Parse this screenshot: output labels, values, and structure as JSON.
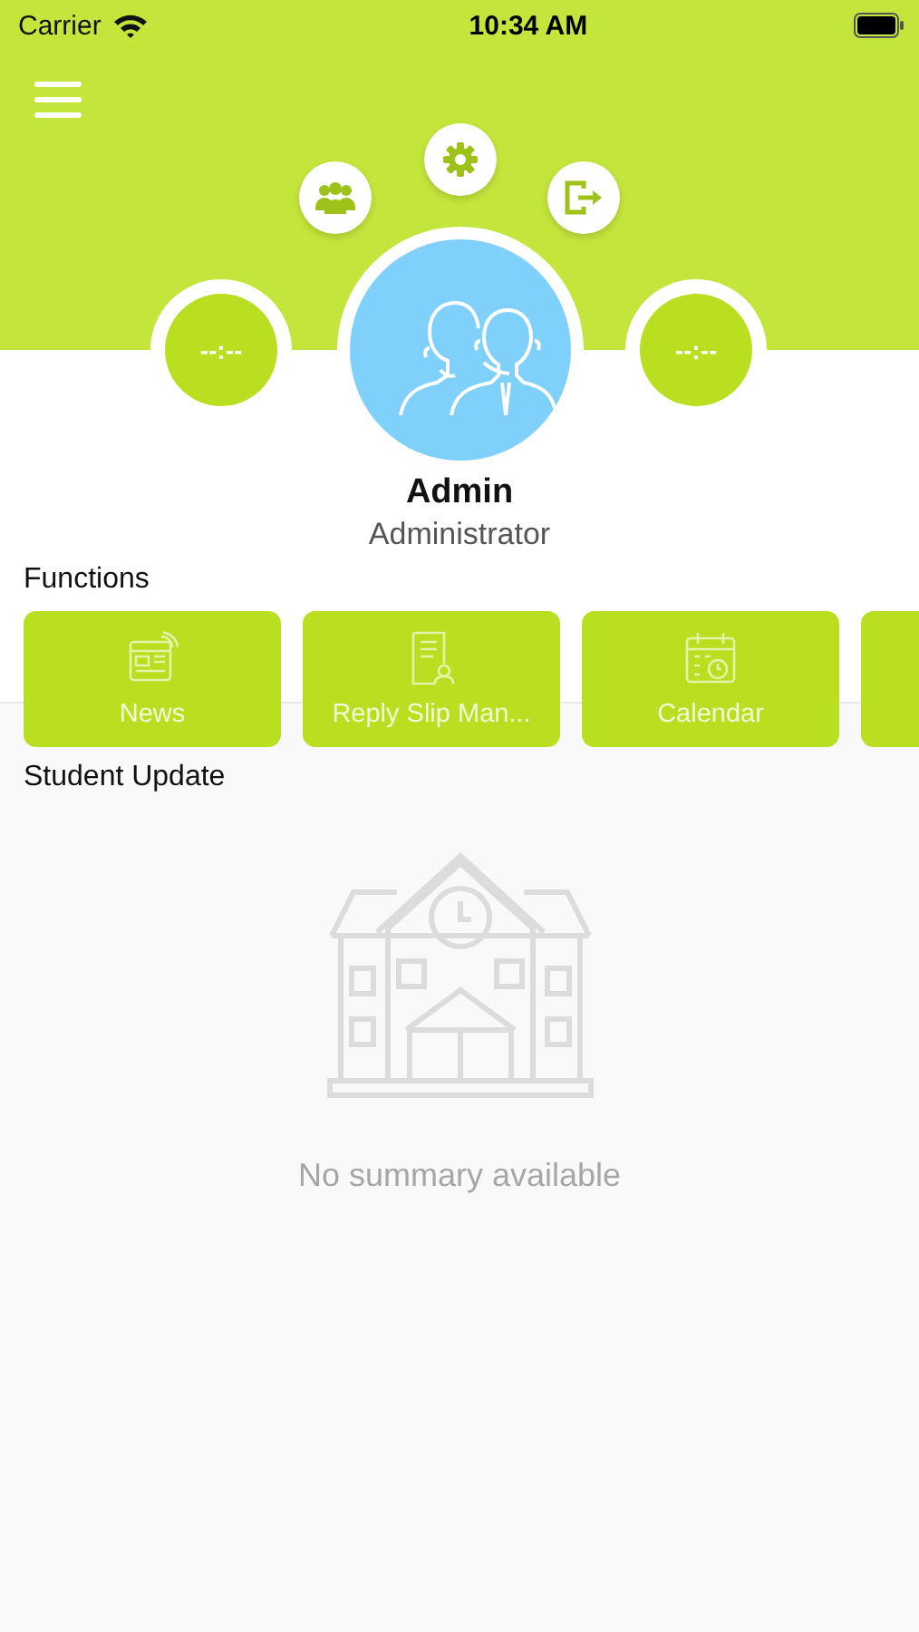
{
  "status_bar": {
    "carrier": "Carrier",
    "time": "10:34 AM"
  },
  "header": {
    "left_timer": "--:--",
    "right_timer": "--:--"
  },
  "profile": {
    "name": "Admin",
    "role": "Administrator"
  },
  "functions": {
    "title": "Functions",
    "items": [
      {
        "label": "News",
        "kind": "news"
      },
      {
        "label": "Reply Slip Man...",
        "kind": "slip"
      },
      {
        "label": "Calendar",
        "kind": "calendar"
      }
    ],
    "more_cut_off": true
  },
  "student_update": {
    "title": "Student Update",
    "empty_message": "No summary available"
  }
}
